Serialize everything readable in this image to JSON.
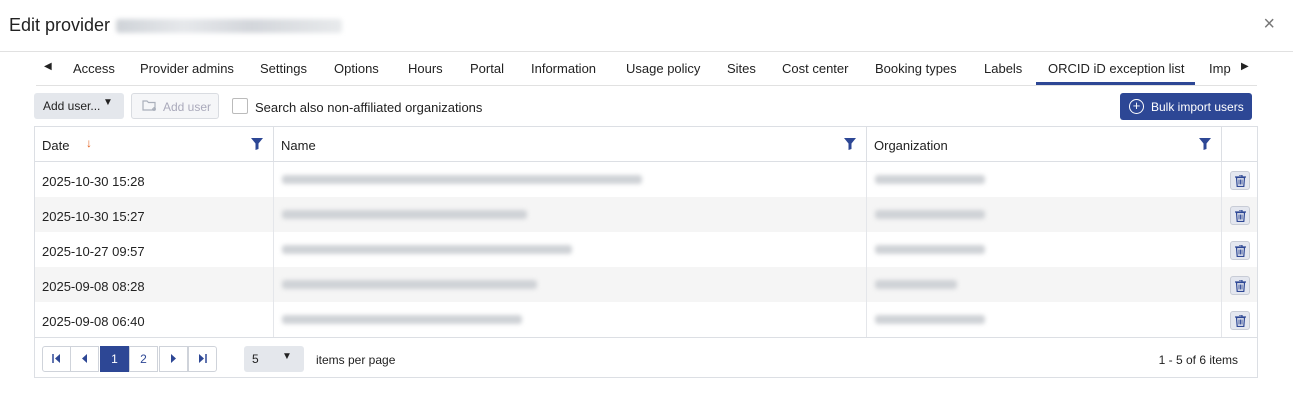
{
  "header": {
    "title": "Edit provider",
    "close_label": "×"
  },
  "tabs": {
    "prev_label": "◀",
    "next_label": "▶",
    "items": [
      {
        "label": "Access"
      },
      {
        "label": "Provider admins"
      },
      {
        "label": "Settings"
      },
      {
        "label": "Options"
      },
      {
        "label": "Hours"
      },
      {
        "label": "Portal"
      },
      {
        "label": "Information"
      },
      {
        "label": "Usage policy"
      },
      {
        "label": "Sites"
      },
      {
        "label": "Cost center"
      },
      {
        "label": "Booking types"
      },
      {
        "label": "Labels"
      },
      {
        "label": "ORCID iD exception list"
      },
      {
        "label": "Imp"
      }
    ],
    "active": "ORCID iD exception list"
  },
  "toolbar": {
    "add_user_dropdown_label": "Add user...",
    "add_user_button_label": "Add user",
    "search_non_affiliated_label": "Search also non-affiliated organizations",
    "search_non_affiliated_checked": false,
    "bulk_import_label": "Bulk import users"
  },
  "table": {
    "columns": [
      {
        "label": "Date",
        "sorted": "descending"
      },
      {
        "label": "Name"
      },
      {
        "label": "Organization"
      }
    ],
    "rows": [
      {
        "date": "2025-10-30 15:28"
      },
      {
        "date": "2025-10-30 15:27"
      },
      {
        "date": "2025-10-27 09:57"
      },
      {
        "date": "2025-09-08 08:28"
      },
      {
        "date": "2025-09-08 06:40"
      }
    ]
  },
  "pager": {
    "pages": [
      "1",
      "2"
    ],
    "current_page": "1",
    "page_size": "5",
    "items_per_page_label": "items per page",
    "count_label": "1 - 5 of 6 items"
  },
  "colors": {
    "accent": "#2d4795",
    "sort_arrow": "#e35d1a",
    "row_alt": "#f5f5f5"
  }
}
